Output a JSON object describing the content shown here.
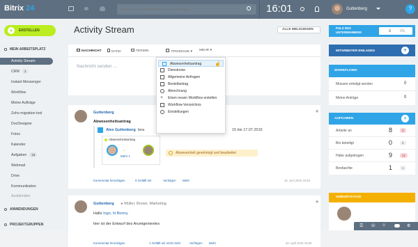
{
  "brand": {
    "name": "Bitrix",
    "num": "24"
  },
  "search": {
    "placeholder": "Suchen nach: Mitarbeiter, Datei, Sonstiges..."
  },
  "clock": "16:01",
  "user": {
    "name": "Guttenberg",
    "help": "?"
  },
  "sidebar": {
    "create": "ERSTELLEN",
    "section1": "MEIN ARBEITSPLATZ",
    "items": [
      {
        "label": "Activity Stream"
      },
      {
        "label": "CRM",
        "badge": "1"
      },
      {
        "label": "Instant Messenger"
      },
      {
        "label": "Workflow"
      },
      {
        "label": "Meine Aufträge"
      },
      {
        "label": "Zoho migration tool"
      },
      {
        "label": "DocDesigner"
      },
      {
        "label": "Fotos"
      },
      {
        "label": "Kalender"
      },
      {
        "label": "Aufgaben",
        "badge": "16"
      },
      {
        "label": "Webmail"
      },
      {
        "label": "Drive"
      },
      {
        "label": "Kommunikation"
      },
      {
        "label": "Ausblenden"
      }
    ],
    "section2": "ANWENDUNGEN",
    "section3": "PROJEKTGRUPPEN"
  },
  "main": {
    "title": "Activity Stream",
    "filter": "ALLE MELDUNGEN",
    "tabs": [
      "NACHRICHT",
      "DATEI",
      "TERMIN",
      "PROZESSE",
      "MEHR"
    ],
    "composer_placeholder": "Nachricht senden ...",
    "dropdown": [
      "Abwesenheitsantrag",
      "Dienstreise",
      "Allgemeine Anfragen",
      "Bestellantrag",
      "Abrechnung",
      "Einen neuen Workflow erstellen",
      "Workflow-Verzeichnis",
      "Einstellungen"
    ],
    "post1": {
      "author": "Guttenberg",
      "title": "Abwesenheitsantrag",
      "inner_author": "Alex Guttenberg",
      "inner_text": "bea",
      "dates": "15 bis 17.07.2015",
      "card_label": "Abwesenheitsantrag",
      "more": "Mehr 1",
      "status": "Abwesenheit genehmigt und bearbeitet",
      "actions": [
        "Kommentar hinzufügen",
        "0 Gefällt mir",
        "Verfolgen",
        "Mehr"
      ],
      "date": "16. Juni 2015 15:28"
    },
    "post2": {
      "author": "Guttenberg",
      "recipients": "Müller, Brown, Marketing",
      "greeting_prefix": "Hallo ",
      "greeting_names": "Ingo, hi Bonny,",
      "body": "hier ist der Entwurf des Anzeigentextes",
      "actions": [
        "Kommentar hinzufügen",
        "1 Gefällt mir nicht mehr",
        "Verfolgen",
        "Mehr"
      ],
      "date": "30. April 2015 15:50"
    }
  },
  "right": {
    "pulse": {
      "label": "PULS DES UNTERNEHMENS",
      "value": "3",
      "percent": "0%"
    },
    "invite": "MITARBEITER EINLADEN",
    "workflows": {
      "title": "WORKFLOWS",
      "items": [
        {
          "label": "Müssen erledigt werden",
          "value": "0"
        },
        {
          "label": "Meine Anträge",
          "value": "0"
        }
      ]
    },
    "tasks": {
      "title": "AUFGABEN",
      "items": [
        {
          "label": "Arbeite an",
          "value": "8",
          "badge": "3"
        },
        {
          "label": "Bin beteiligt",
          "value": "0",
          "badge": "0"
        },
        {
          "label": "Habe aufgetragen",
          "value": "9",
          "badge": "11"
        },
        {
          "label": "Beobachte",
          "value": "1",
          "badge": "1"
        }
      ]
    },
    "birthdays": "GEBURTSTAGE"
  },
  "colors": {
    "topbar": "#5d6f80",
    "accent_green": "#bbed21",
    "blue": "#2fa4e7",
    "sidebar_active": "#5d6f80"
  }
}
